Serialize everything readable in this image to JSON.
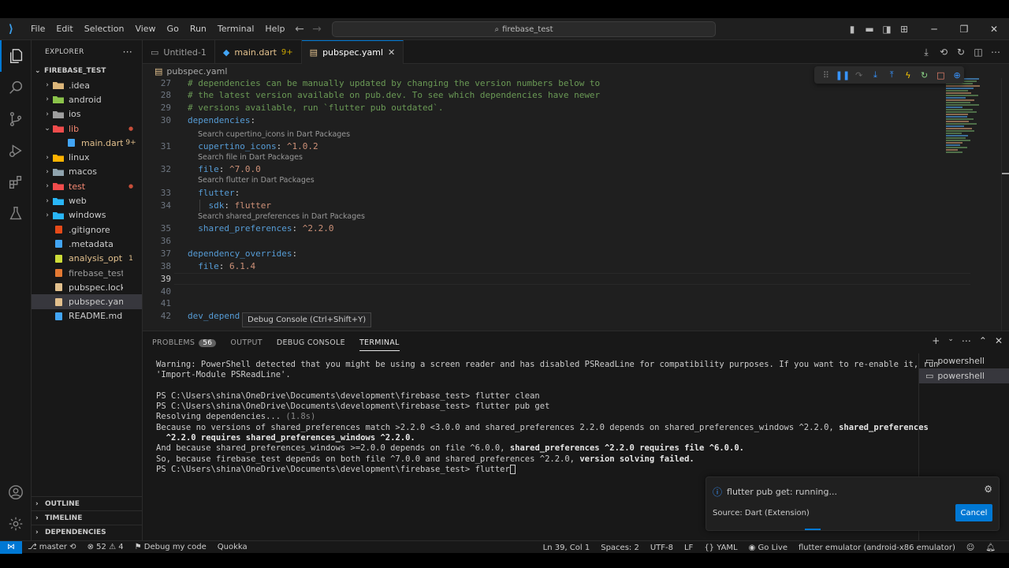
{
  "titlebar": {
    "menu": [
      "File",
      "Edit",
      "Selection",
      "View",
      "Go",
      "Run",
      "Terminal",
      "Help"
    ],
    "search": "firebase_test"
  },
  "explorer": {
    "header": "EXPLORER",
    "more": "···",
    "root": "FIREBASE_TEST",
    "items": [
      {
        "label": ".idea",
        "type": "folder",
        "color": "#dcb67a"
      },
      {
        "label": "android",
        "type": "folder",
        "color": "#8bc34a"
      },
      {
        "label": "ios",
        "type": "folder",
        "color": "#9e9e9e"
      },
      {
        "label": "lib",
        "type": "folder-open",
        "color": "#f14c4c",
        "textColor": "#f48771"
      },
      {
        "label": "main.dart",
        "type": "file",
        "color": "#42a5f5",
        "deco": "9+",
        "textColor": "#e2c08d"
      },
      {
        "label": "linux",
        "type": "folder",
        "color": "#ffb300"
      },
      {
        "label": "macos",
        "type": "folder",
        "color": "#90a4ae"
      },
      {
        "label": "test",
        "type": "folder",
        "color": "#f14c4c",
        "textColor": "#f48771"
      },
      {
        "label": "web",
        "type": "folder",
        "color": "#29b6f6"
      },
      {
        "label": "windows",
        "type": "folder",
        "color": "#29b6f6"
      },
      {
        "label": ".gitignore",
        "type": "file",
        "color": "#e64a19"
      },
      {
        "label": ".metadata",
        "type": "file",
        "color": "#42a5f5"
      },
      {
        "label": "analysis_opti...",
        "type": "file",
        "color": "#cddc39",
        "deco": "1",
        "textColor": "#e2c08d"
      },
      {
        "label": "firebase_test.iml",
        "type": "file",
        "color": "#e37933",
        "textColor": "#9d9d9d"
      },
      {
        "label": "pubspec.lock",
        "type": "file",
        "color": "#e2c08d"
      },
      {
        "label": "pubspec.yaml",
        "type": "file",
        "color": "#e2c08d"
      },
      {
        "label": "README.md",
        "type": "file",
        "color": "#42a5f5"
      }
    ],
    "sections": [
      "OUTLINE",
      "TIMELINE",
      "DEPENDENCIES"
    ]
  },
  "tabs": [
    {
      "label": "Untitled-1",
      "badge": ""
    },
    {
      "label": "main.dart",
      "badge": "9+"
    },
    {
      "label": "pubspec.yaml",
      "badge": ""
    }
  ],
  "breadcrumb": "pubspec.yaml",
  "editor": {
    "top_partial": "# dependencies can be manually updated by changing the version numbers below to",
    "lines": [
      {
        "n": "27",
        "parts": [
          [
            "comment",
            "# dependencies can be manually updated by changing the version numbers below to"
          ]
        ]
      },
      {
        "n": "28",
        "parts": [
          [
            "comment",
            "# the latest version available on pub.dev. To see which dependencies have newer"
          ]
        ]
      },
      {
        "n": "29",
        "parts": [
          [
            "comment",
            "# versions available, run `flutter pub outdated`."
          ]
        ]
      },
      {
        "n": "30",
        "parts": [
          [
            "key",
            "dependencies"
          ],
          [
            "plain",
            ":"
          ]
        ]
      },
      {
        "n": "31",
        "lens": "Search cupertino_icons in Dart Packages",
        "parts": [
          [
            "plain",
            "  "
          ],
          [
            "key",
            "cupertino_icons"
          ],
          [
            "plain",
            ": "
          ],
          [
            "str",
            "^1.0.2"
          ]
        ]
      },
      {
        "n": "32",
        "lens": "Search file in Dart Packages",
        "parts": [
          [
            "plain",
            "  "
          ],
          [
            "key",
            "file"
          ],
          [
            "plain",
            ": "
          ],
          [
            "str",
            "^7.0.0"
          ]
        ]
      },
      {
        "n": "33",
        "lens": "Search flutter in Dart Packages",
        "parts": [
          [
            "plain",
            "  "
          ],
          [
            "key",
            "flutter"
          ],
          [
            "plain",
            ":"
          ]
        ]
      },
      {
        "n": "34",
        "parts": [
          [
            "plain",
            "    "
          ],
          [
            "key",
            "sdk"
          ],
          [
            "plain",
            ": "
          ],
          [
            "str",
            "flutter"
          ]
        ]
      },
      {
        "n": "35",
        "lens": "Search shared_preferences in Dart Packages",
        "parts": [
          [
            "plain",
            "  "
          ],
          [
            "key",
            "shared_preferences"
          ],
          [
            "plain",
            ": "
          ],
          [
            "str",
            "^2.2.0"
          ]
        ]
      },
      {
        "n": "36",
        "parts": []
      },
      {
        "n": "37",
        "parts": [
          [
            "key",
            "dependency_overrides"
          ],
          [
            "plain",
            ":"
          ]
        ]
      },
      {
        "n": "38",
        "parts": [
          [
            "plain",
            "  "
          ],
          [
            "key",
            "file"
          ],
          [
            "plain",
            ": "
          ],
          [
            "str",
            "6.1.4"
          ]
        ]
      },
      {
        "n": "39",
        "parts": []
      },
      {
        "n": "40",
        "parts": []
      },
      {
        "n": "41",
        "parts": []
      },
      {
        "n": "42",
        "parts": [
          [
            "key",
            "dev_depend"
          ]
        ]
      }
    ],
    "tooltip": "Debug Console (Ctrl+Shift+Y)"
  },
  "panel": {
    "tabs": [
      "PROBLEMS",
      "OUTPUT",
      "DEBUG CONSOLE",
      "TERMINAL"
    ],
    "problems_count": "56",
    "terminal_lines": [
      "Warning: PowerShell detected that you might be using a screen reader and has disabled PSReadLine for compatibility purposes. If you want to re-enable it, run",
      "'Import-Module PSReadLine'.",
      "",
      "PS C:\\Users\\shina\\OneDrive\\Documents\\development\\firebase_test> flutter clean",
      "PS C:\\Users\\shina\\OneDrive\\Documents\\development\\firebase_test> flutter pub get",
      "Resolving dependencies... (1.8s)"
    ],
    "error_lines": [
      [
        "Because no versions of shared_preferences match >2.2.0 <3.0.0 and shared_preferences 2.2.0 depends on shared_preferences_windows ^2.2.0, ",
        "shared_preferences"
      ],
      [
        "  ",
        "^2.2.0 requires shared_preferences_windows ^2.2.0."
      ],
      [
        "And because shared_preferences_windows >=2.0.0 depends on file ^6.0.0, ",
        "shared_preferences ^2.2.0 requires file ^6.0.0."
      ],
      [
        "So, because firebase_test depends on both file ^7.0.0 and shared_preferences ^2.2.0, ",
        "version solving failed."
      ]
    ],
    "prompt": "PS C:\\Users\\shina\\OneDrive\\Documents\\development\\firebase_test> flutter",
    "terminals": [
      "powershell",
      "powershell"
    ]
  },
  "notification": {
    "message": "flutter pub get: running...",
    "source": "Source: Dart (Extension)",
    "cancel": "Cancel"
  },
  "status": {
    "branch": "master",
    "errors": "52",
    "warnings": "4",
    "debug": "Debug my code",
    "quokka": "Quokka",
    "position": "Ln 39, Col 1",
    "spaces": "Spaces: 2",
    "encoding": "UTF-8",
    "eol": "LF",
    "language": "YAML",
    "golive": "Go Live",
    "device": "flutter emulator (android-x86 emulator)"
  }
}
